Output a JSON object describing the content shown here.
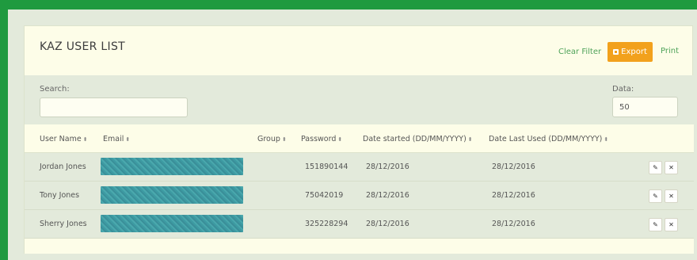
{
  "panel": {
    "title": "KAZ USER LIST",
    "clear_filter": "Clear Filter",
    "export_label": "Export",
    "print_label": "Print"
  },
  "filters": {
    "search_label": "Search:",
    "search_value": "",
    "data_label": "Data:",
    "data_value": "50"
  },
  "table": {
    "columns": [
      "User Name",
      "Email",
      "Group",
      "Password",
      "Date started (DD/MM/YYYY)",
      "Date Last Used (DD/MM/YYYY)"
    ],
    "rows": [
      {
        "user_name": "Jordan Jones",
        "email_redacted": true,
        "group": "",
        "password": "151890144",
        "date_started": "28/12/2016",
        "date_last_used": "28/12/2016"
      },
      {
        "user_name": "Tony Jones",
        "email_redacted": true,
        "group": "",
        "password": "75042019",
        "date_started": "28/12/2016",
        "date_last_used": "28/12/2016"
      },
      {
        "user_name": "Sherry Jones",
        "email_redacted": true,
        "group": "",
        "password": "325228294",
        "date_started": "28/12/2016",
        "date_last_used": "28/12/2016"
      }
    ]
  },
  "icons": {
    "sort": "sort-icon",
    "edit": "pencil-icon",
    "delete": "close-icon",
    "export": "export-icon"
  },
  "colors": {
    "frame": "#1f9a3f",
    "accent": "#f2a11c",
    "link": "#4fa35a",
    "panel_bg": "#fdfde8",
    "row_bg": "#e3eadb",
    "redaction": "#3d9aa2"
  }
}
